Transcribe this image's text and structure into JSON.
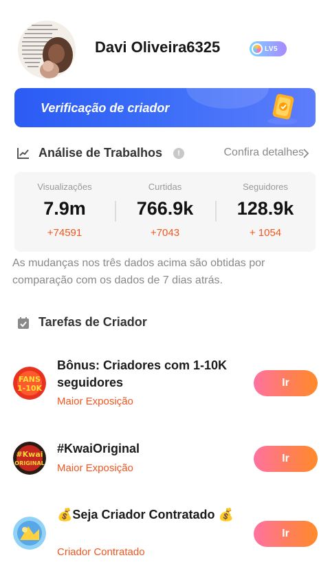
{
  "profile": {
    "username": "Davi Oliveira6325",
    "level_badge": "LV5",
    "avatar_icon": "avatar-photo"
  },
  "banner": {
    "title": "Verificação de criador",
    "color_start": "#2b5bf4",
    "color_end": "#5d7dfb"
  },
  "analysis": {
    "title": "Análise de Trabalhos",
    "details_link": "Confira detalhes",
    "stats": [
      {
        "label": "Visualizações",
        "value": "7.9m",
        "delta": "+74591"
      },
      {
        "label": "Curtidas",
        "value": "766.9k",
        "delta": "+7043"
      },
      {
        "label": "Seguidores",
        "value": "128.9k",
        "delta": "+ 1054"
      }
    ],
    "note": "As mudanças nos três dados acima são obtidas por comparação com os dados de 7 dias atrás."
  },
  "tasks": {
    "title": "Tarefas de Criador",
    "button_label": "Ir",
    "items": [
      {
        "title": "Bônus: Criadores com 1-10K seguidores",
        "subtitle": "Maior Exposição",
        "icon": "fans-1-10k-icon"
      },
      {
        "title": "#KwaiOriginal",
        "subtitle": "Maior Exposição",
        "icon": "kwai-original-icon"
      },
      {
        "title": "💰Seja Criador Contratado 💰",
        "subtitle": "Criador Contratado",
        "icon": "contracted-creator-icon"
      }
    ]
  },
  "colors": {
    "accent_orange": "#f2561d",
    "button_gradient": [
      "#ff72a0",
      "#ff8a2a"
    ],
    "muted_text": "#888888"
  }
}
